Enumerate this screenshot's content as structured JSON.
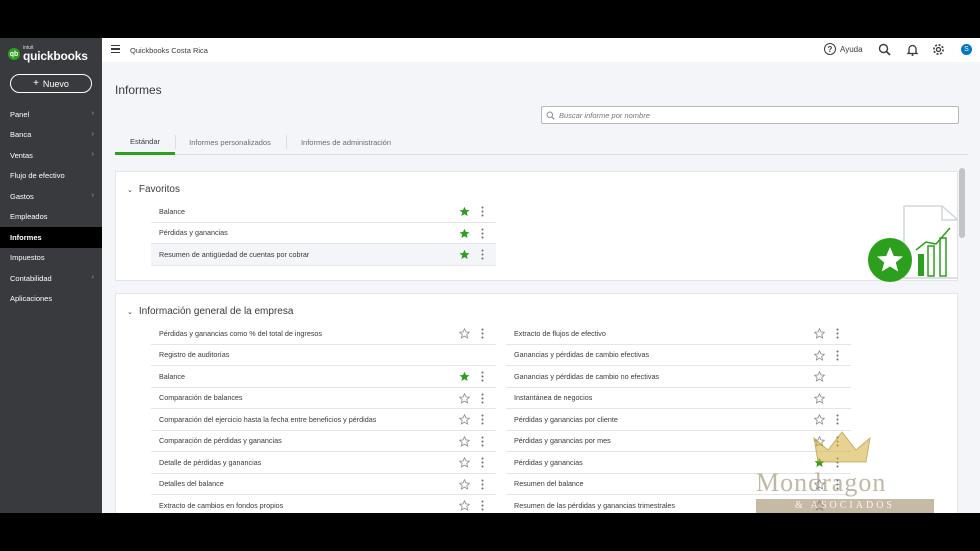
{
  "app": {
    "logo_small": "intuit",
    "logo_main": "quickbooks",
    "company": "Quickbooks Costa Rica",
    "help_label": "Ayuda",
    "avatar_letter": "S"
  },
  "sidebar": {
    "new_button": "Nuevo",
    "items": [
      {
        "label": "Panel",
        "chevron": true
      },
      {
        "label": "Banca",
        "chevron": true
      },
      {
        "label": "Ventas",
        "chevron": true
      },
      {
        "label": "Flujo de efectivo",
        "chevron": false
      },
      {
        "label": "Gastos",
        "chevron": true
      },
      {
        "label": "Empleados",
        "chevron": false
      },
      {
        "label": "Informes",
        "chevron": false,
        "active": true
      },
      {
        "label": "Impuestos",
        "chevron": false
      },
      {
        "label": "Contabilidad",
        "chevron": true
      },
      {
        "label": "Aplicaciones",
        "chevron": false
      }
    ]
  },
  "page": {
    "title": "Informes",
    "search_placeholder": "Buscar informe por nombre",
    "tabs": [
      "Estándar",
      "Informes personalizados",
      "Informes de administración"
    ]
  },
  "favorites": {
    "title": "Favoritos",
    "items": [
      {
        "label": "Balance",
        "starred": true
      },
      {
        "label": "Pérdidas y ganancias",
        "starred": true
      },
      {
        "label": "Resumen de antigüedad de cuentas por cobrar",
        "starred": true
      }
    ]
  },
  "general": {
    "title": "Información general de la empresa",
    "left": [
      {
        "label": "Pérdidas y ganancias como % del total de ingresos",
        "starred": false,
        "kebab": true
      },
      {
        "label": "Registro de auditorías",
        "starred": null,
        "kebab": false
      },
      {
        "label": "Balance",
        "starred": true,
        "kebab": true
      },
      {
        "label": "Comparación de balances",
        "starred": false,
        "kebab": true
      },
      {
        "label": "Comparación del ejercicio hasta la fecha entre beneficios y pérdidas",
        "starred": false,
        "kebab": true
      },
      {
        "label": "Comparación de pérdidas y ganancias",
        "starred": false,
        "kebab": true
      },
      {
        "label": "Detalle de pérdidas y ganancias",
        "starred": false,
        "kebab": true
      },
      {
        "label": "Detalles del balance",
        "starred": false,
        "kebab": true
      },
      {
        "label": "Extracto de cambios en fondos propios",
        "starred": false,
        "kebab": true
      }
    ],
    "right": [
      {
        "label": "Extracto de flujos de efectivo",
        "starred": false,
        "kebab": true
      },
      {
        "label": "Ganancias y pérdidas de cambio efectivas",
        "starred": false,
        "kebab": true
      },
      {
        "label": "Ganancias y pérdidas de cambio no efectivas",
        "starred": false,
        "kebab": false
      },
      {
        "label": "Instantánea de negocios",
        "starred": false,
        "kebab": false
      },
      {
        "label": "Pérdidas y ganancias por cliente",
        "starred": false,
        "kebab": true
      },
      {
        "label": "Pérdidas y ganancias por mes",
        "starred": false,
        "kebab": true
      },
      {
        "label": "Pérdidas y ganancias",
        "starred": true,
        "kebab": true
      },
      {
        "label": "Resumen del balance",
        "starred": false,
        "kebab": true
      },
      {
        "label": "Resumen de las pérdidas y ganancias trimestrales",
        "starred": false,
        "kebab": false
      }
    ]
  },
  "watermark": {
    "name": "Mondragon",
    "sub": "& ASOCIADOS"
  },
  "colors": {
    "green": "#2ca01c",
    "sidebar": "#393a3d",
    "star_outline": "#8d9096"
  }
}
